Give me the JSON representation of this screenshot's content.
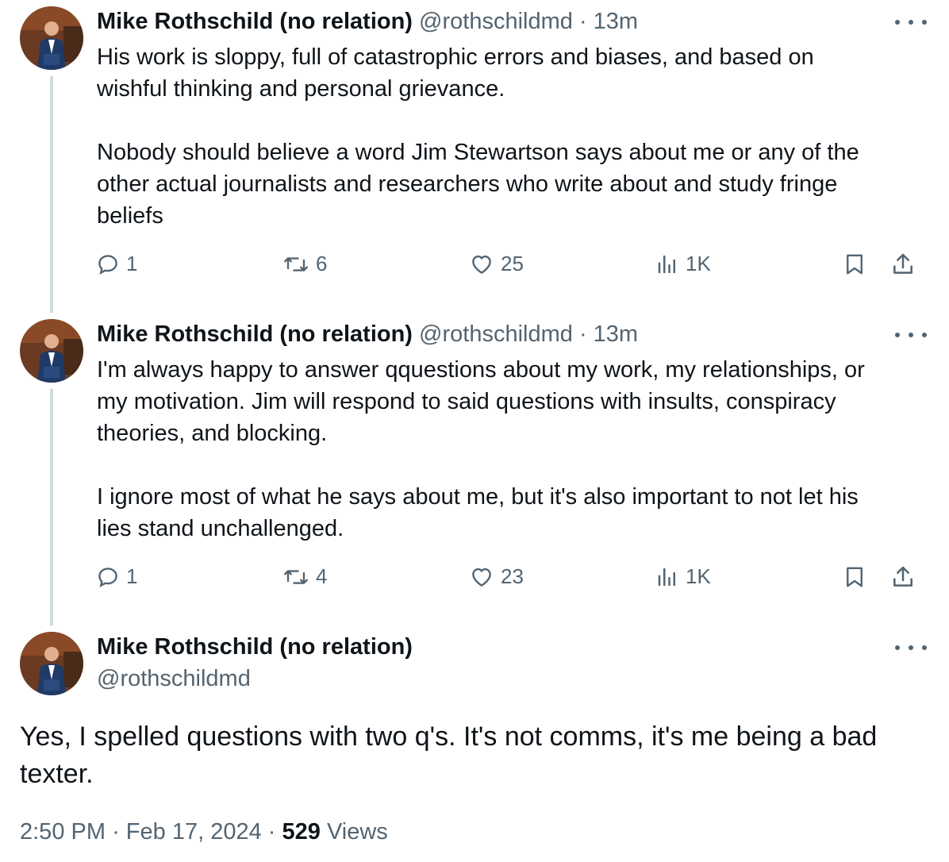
{
  "tweets": [
    {
      "name": "Mike Rothschild (no relation)",
      "handle": "@rothschildmd",
      "sep": "·",
      "time": "13m",
      "text": "His work is sloppy, full of catastrophic errors and biases, and based on\nwishful thinking and personal grievance.\n\nNobody should believe a word Jim Stewartson says about me or any of the\nother actual journalists and researchers who write about and study fringe\nbeliefs",
      "replies": "1",
      "reposts": "6",
      "likes": "25",
      "views": "1K"
    },
    {
      "name": "Mike Rothschild (no relation)",
      "handle": "@rothschildmd",
      "sep": "·",
      "time": "13m",
      "text": "I'm always happy to answer qquestions about my work, my relationships, or\nmy motivation. Jim will respond to said questions with insults, conspiracy\ntheories, and blocking.\n\nI ignore most of what he says about me, but it's also important to not let his\nlies stand unchallenged.",
      "replies": "1",
      "reposts": "4",
      "likes": "23",
      "views": "1K"
    }
  ],
  "main": {
    "name": "Mike Rothschild (no relation)",
    "handle": "@rothschildmd",
    "text": "Yes, I spelled questions with two q's. It's not comms, it's me being a bad\ntexter.",
    "time": "2:50 PM",
    "sep1": "·",
    "date": "Feb 17, 2024",
    "sep2": "·",
    "views_count": "529",
    "views_label": "Views"
  },
  "colors": {
    "text": "#0f1419",
    "secondary": "#536471",
    "thread_line": "#cfd9de"
  }
}
